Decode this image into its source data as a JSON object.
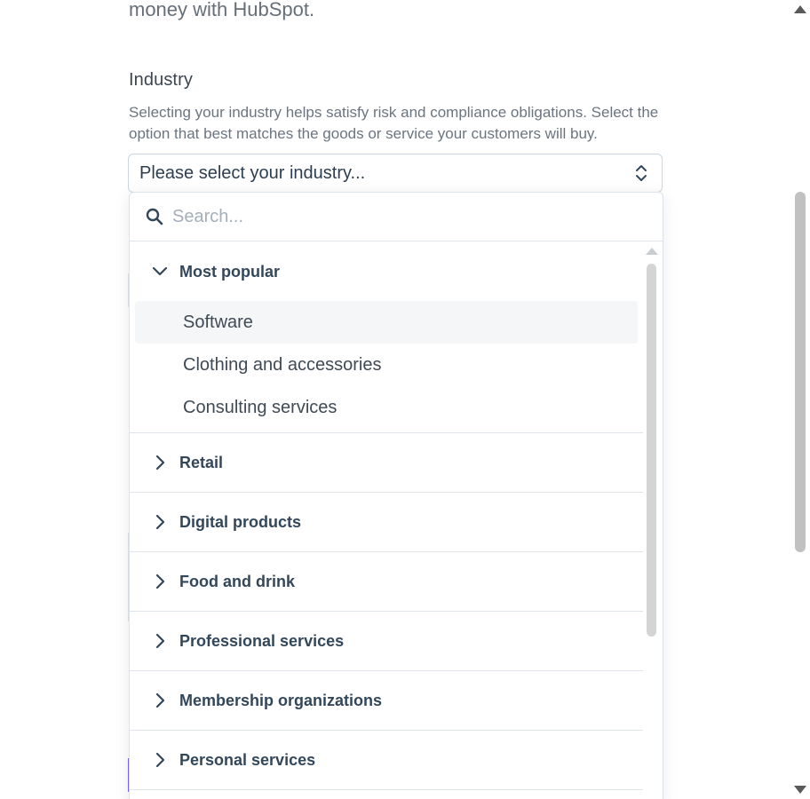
{
  "intro": {
    "text": "money with HubSpot."
  },
  "industry": {
    "label": "Industry",
    "help": "Selecting your industry helps satisfy risk and compliance obligations. Select the option that best matches the goods or service your customers will buy.",
    "select_value": "Please select your industry..."
  },
  "dropdown": {
    "search_placeholder": "Search...",
    "popular": {
      "label": "Most popular",
      "options": [
        "Software",
        "Clothing and accessories",
        "Consulting services"
      ]
    },
    "groups": [
      "Retail",
      "Digital products",
      "Food and drink",
      "Professional services",
      "Membership organizations",
      "Personal services"
    ]
  },
  "icons": {
    "search": "search-icon",
    "select_caret": "up-down-caret-icon",
    "expanded": "chevron-down-icon",
    "collapsed": "chevron-right-icon"
  }
}
